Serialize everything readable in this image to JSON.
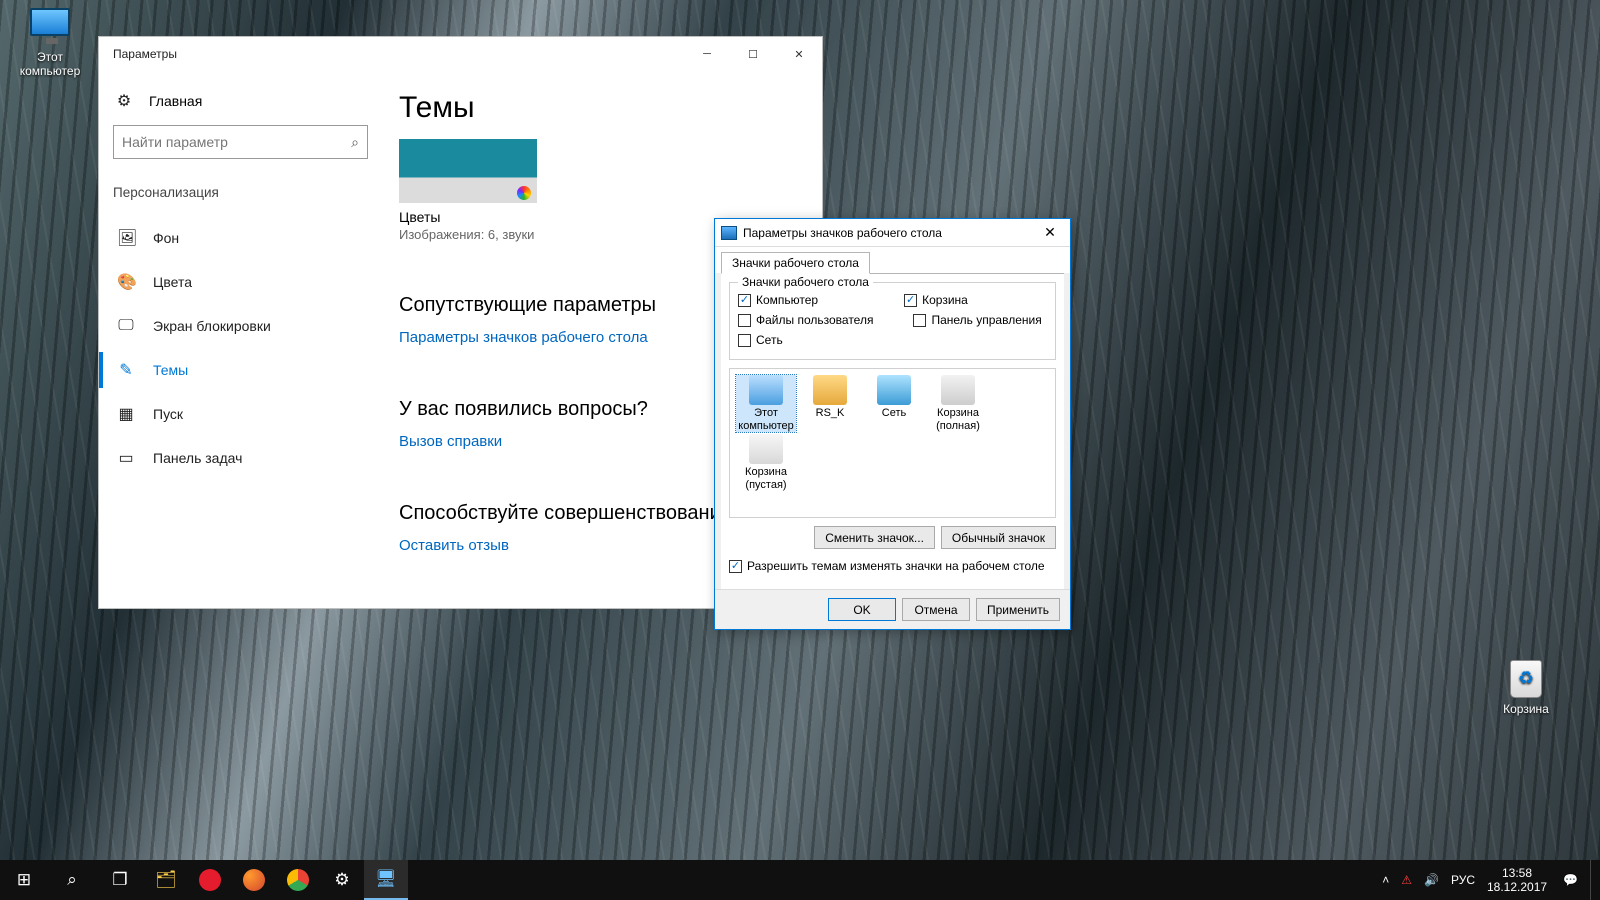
{
  "desktop": {
    "this_pc": "Этот\nкомпьютер",
    "recycle": "Корзина"
  },
  "settings": {
    "title": "Параметры",
    "home": "Главная",
    "search_placeholder": "Найти параметр",
    "section": "Персонализация",
    "nav": {
      "background": "Фон",
      "colors": "Цвета",
      "lockscreen": "Экран блокировки",
      "themes": "Темы",
      "start": "Пуск",
      "taskbar": "Панель задач"
    },
    "main": {
      "title": "Темы",
      "theme_name": "Цветы",
      "theme_meta": "Изображения: 6, звуки",
      "related_h": "Сопутствующие параметры",
      "related_link": "Параметры значков рабочего стола",
      "questions_h": "У вас появились вопросы?",
      "help_link": "Вызов справки",
      "improve_h": "Способствуйте совершенствованию",
      "feedback_link": "Оставить отзыв"
    }
  },
  "dialog": {
    "title": "Параметры значков рабочего стола",
    "tab": "Значки рабочего стола",
    "group": "Значки рабочего стола",
    "checks": {
      "computer": "Компьютер",
      "recycle": "Корзина",
      "userfiles": "Файлы пользователя",
      "control": "Панель управления",
      "network": "Сеть"
    },
    "icons": {
      "pc": "Этот\nкомпьютер",
      "user": "RS_K",
      "net": "Сеть",
      "bin_full": "Корзина\n(полная)",
      "bin_empty": "Корзина\n(пустая)"
    },
    "change_btn": "Сменить значок...",
    "default_btn": "Обычный значок",
    "allow_themes": "Разрешить темам изменять значки на рабочем столе",
    "ok": "OK",
    "cancel": "Отмена",
    "apply": "Применить"
  },
  "taskbar": {
    "lang": "РУС",
    "time": "13:58",
    "date": "18.12.2017"
  }
}
